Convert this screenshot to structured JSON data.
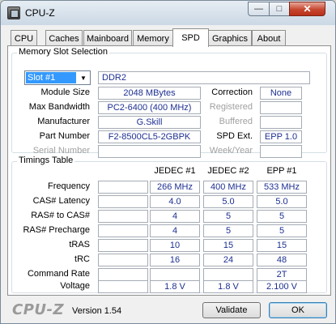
{
  "window": {
    "title": "CPU-Z"
  },
  "tabs": [
    {
      "label": "CPU"
    },
    {
      "label": "Caches"
    },
    {
      "label": "Mainboard"
    },
    {
      "label": "Memory"
    },
    {
      "label": "SPD"
    },
    {
      "label": "Graphics"
    },
    {
      "label": "About"
    }
  ],
  "active_tab": "SPD",
  "slot": {
    "group_title": "Memory Slot Selection",
    "selected": "Slot #1",
    "type": "DDR2",
    "labels": {
      "module_size": "Module Size",
      "max_bandwidth": "Max Bandwidth",
      "manufacturer": "Manufacturer",
      "part_number": "Part Number",
      "serial_number": "Serial Number",
      "correction": "Correction",
      "registered": "Registered",
      "buffered": "Buffered",
      "spd_ext": "SPD Ext.",
      "week_year": "Week/Year"
    },
    "values": {
      "module_size": "2048 MBytes",
      "max_bandwidth": "PC2-6400 (400 MHz)",
      "manufacturer": "G.Skill",
      "part_number": "F2-8500CL5-2GBPK",
      "serial_number": "",
      "correction": "None",
      "registered": "",
      "buffered": "",
      "spd_ext": "EPP 1.0",
      "week_year": ""
    }
  },
  "timings": {
    "group_title": "Timings Table",
    "columns": [
      "JEDEC #1",
      "JEDEC #2",
      "EPP #1"
    ],
    "rows": [
      {
        "label": "Frequency",
        "values": [
          "266 MHz",
          "400 MHz",
          "533 MHz"
        ]
      },
      {
        "label": "CAS# Latency",
        "values": [
          "4.0",
          "5.0",
          "5.0"
        ]
      },
      {
        "label": "RAS# to CAS#",
        "values": [
          "4",
          "5",
          "5"
        ]
      },
      {
        "label": "RAS# Precharge",
        "values": [
          "4",
          "5",
          "5"
        ]
      },
      {
        "label": "tRAS",
        "values": [
          "10",
          "15",
          "15"
        ]
      },
      {
        "label": "tRC",
        "values": [
          "16",
          "24",
          "48"
        ]
      },
      {
        "label": "Command Rate",
        "values": [
          "",
          "",
          "2T"
        ]
      },
      {
        "label": "Voltage",
        "values": [
          "1.8 V",
          "1.8 V",
          "2.100 V"
        ]
      }
    ]
  },
  "footer": {
    "logo": "CPU-Z",
    "version": "Version 1.54",
    "validate_label": "Validate",
    "ok_label": "OK"
  },
  "colors": {
    "value_text": "#1c2f91",
    "selection": "#3399ff"
  }
}
